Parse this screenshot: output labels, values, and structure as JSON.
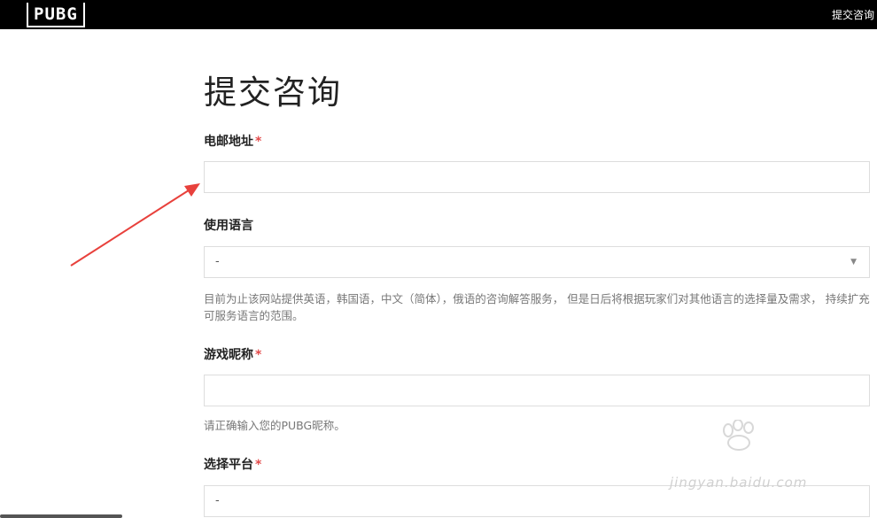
{
  "header": {
    "logo_text": "PUBG",
    "top_link": "提交咨询"
  },
  "form": {
    "title": "提交咨询",
    "email": {
      "label": "电邮地址",
      "required_mark": "*",
      "value": ""
    },
    "language": {
      "label": "使用语言",
      "selected": "-",
      "arrow": "▼",
      "help": "目前为止该网站提供英语，韩国语，中文（简体），俄语的咨询解答服务， 但是日后将根据玩家们对其他语言的选择量及需求， 持续扩充可服务语言的范围。"
    },
    "nickname": {
      "label": "游戏昵称",
      "required_mark": "*",
      "value": "",
      "help": "请正确输入您的PUBG昵称。"
    },
    "platform": {
      "label": "选择平台",
      "required_mark": "*",
      "selected": "-"
    }
  },
  "watermark": {
    "text": "jingyan.baidu.com"
  },
  "colors": {
    "header_bg": "#000000",
    "required": "#e34b4b",
    "arrow": "#e8413c"
  }
}
